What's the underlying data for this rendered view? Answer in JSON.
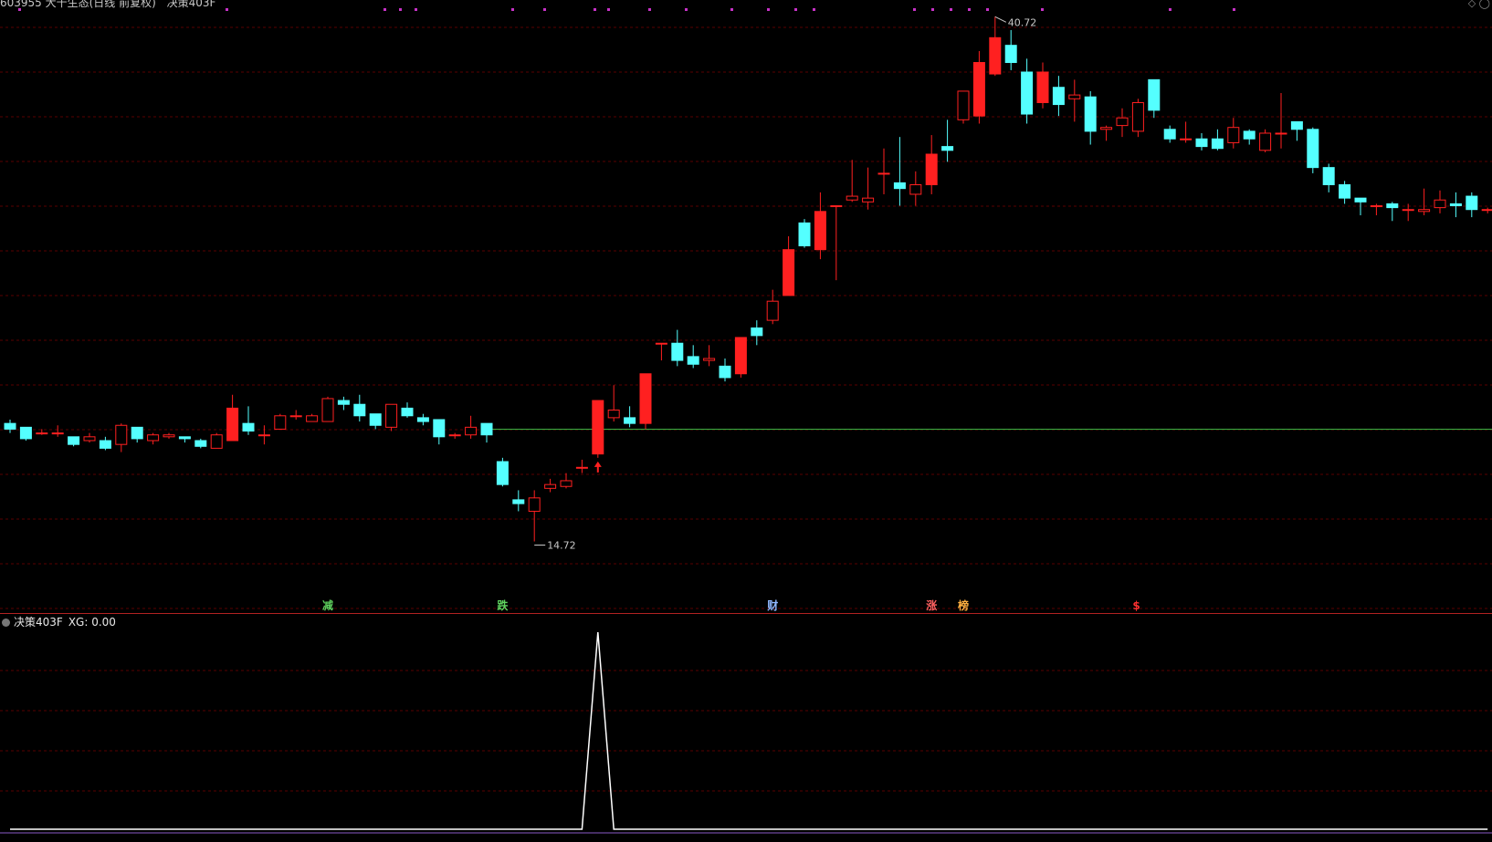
{
  "header": {
    "stock_title": "603955 大千生态(日线 前复权)",
    "formula_title": "决策403F",
    "corner_icon": "diamond-icon"
  },
  "indicator": {
    "name": "决策403F",
    "value_text": "XG: 0.00"
  },
  "price_labels": {
    "high": "40.72",
    "low": "14.72"
  },
  "signals": [
    {
      "text": "减",
      "index": 20,
      "color": "#5fd35f"
    },
    {
      "text": "跌",
      "index": 31,
      "color": "#5fd35f"
    },
    {
      "text": "财",
      "index": 48,
      "color": "#8fb7ff"
    },
    {
      "text": "涨",
      "index": 58,
      "color": "#ff6060"
    },
    {
      "text": "榜",
      "index": 60,
      "color": "#ffb040"
    },
    {
      "text": "$",
      "index": 71,
      "color": "#ff3030"
    }
  ],
  "colors": {
    "up": "#ff2020",
    "down": "#54ffff",
    "grid": "#5a0000",
    "support_line": "#3cb043",
    "indicator_line": "#ffffff",
    "dots": "#c832c8"
  },
  "chart_data": {
    "type": "candlestick",
    "price_range": [
      12.5,
      42.5
    ],
    "support_level": 20.6,
    "high_label_value": 40.72,
    "low_label_value": 14.72,
    "candles": [
      [
        20.9,
        20.6,
        21.1,
        20.4
      ],
      [
        20.7,
        20.1,
        20.7,
        20.0
      ],
      [
        20.4,
        20.4,
        20.6,
        20.3
      ],
      [
        20.4,
        20.4,
        20.8,
        20.2
      ],
      [
        20.2,
        19.8,
        20.2,
        19.7
      ],
      [
        20.0,
        20.2,
        20.4,
        19.9
      ],
      [
        20.0,
        19.6,
        20.2,
        19.5
      ],
      [
        19.8,
        20.8,
        20.9,
        19.4
      ],
      [
        20.7,
        20.1,
        20.7,
        19.9
      ],
      [
        20.0,
        20.3,
        20.4,
        19.8
      ],
      [
        20.2,
        20.3,
        20.4,
        20.1
      ],
      [
        20.2,
        20.1,
        20.2,
        19.9
      ],
      [
        20.0,
        19.7,
        20.1,
        19.6
      ],
      [
        19.6,
        20.3,
        20.4,
        19.6
      ],
      [
        20.0,
        21.7,
        22.4,
        20.0
      ],
      [
        20.9,
        20.5,
        21.8,
        20.3
      ],
      [
        20.3,
        20.3,
        20.8,
        19.8
      ],
      [
        20.6,
        21.3,
        21.4,
        20.6
      ],
      [
        21.3,
        21.3,
        21.6,
        21.1
      ],
      [
        21.0,
        21.3,
        21.4,
        21.0
      ],
      [
        21.0,
        22.2,
        22.3,
        21.0
      ],
      [
        22.1,
        21.9,
        22.3,
        21.6
      ],
      [
        21.9,
        21.3,
        22.4,
        21.0
      ],
      [
        21.4,
        20.8,
        21.4,
        20.6
      ],
      [
        20.7,
        21.9,
        21.9,
        20.5
      ],
      [
        21.7,
        21.3,
        22.0,
        21.2
      ],
      [
        21.2,
        21.0,
        21.4,
        20.8
      ],
      [
        21.1,
        20.2,
        21.1,
        19.8
      ],
      [
        20.3,
        20.3,
        20.4,
        20.1
      ],
      [
        20.3,
        20.7,
        21.3,
        20.1
      ],
      [
        20.9,
        20.3,
        20.9,
        19.9
      ],
      [
        18.9,
        17.7,
        19.1,
        17.6
      ],
      [
        16.9,
        16.7,
        17.4,
        16.3
      ],
      [
        16.3,
        17.0,
        17.4,
        14.72
      ],
      [
        17.5,
        17.7,
        18.0,
        17.3
      ],
      [
        17.6,
        17.9,
        18.3,
        17.5
      ],
      [
        18.6,
        18.6,
        19.0,
        18.3
      ],
      [
        19.3,
        22.1,
        22.1,
        19.1
      ],
      [
        21.2,
        21.6,
        22.9,
        21.0
      ],
      [
        21.2,
        20.9,
        21.8,
        20.7
      ],
      [
        20.9,
        23.5,
        23.5,
        20.6
      ],
      [
        25.1,
        25.1,
        25.1,
        24.2
      ],
      [
        25.1,
        24.2,
        25.8,
        23.9
      ],
      [
        24.4,
        24.0,
        25.0,
        23.8
      ],
      [
        24.2,
        24.3,
        25.0,
        23.9
      ],
      [
        23.9,
        23.3,
        24.3,
        23.1
      ],
      [
        23.5,
        25.4,
        25.4,
        23.3
      ],
      [
        25.9,
        25.5,
        26.3,
        25.0
      ],
      [
        26.3,
        27.3,
        27.9,
        26.1
      ],
      [
        27.6,
        30.0,
        30.7,
        27.6
      ],
      [
        31.4,
        30.2,
        31.6,
        30.1
      ],
      [
        30.0,
        32.0,
        33.0,
        29.5
      ],
      [
        32.3,
        32.3,
        32.3,
        28.4
      ],
      [
        32.6,
        32.8,
        34.7,
        32.5
      ],
      [
        32.5,
        32.7,
        34.3,
        32.1
      ],
      [
        34.0,
        34.0,
        35.3,
        32.9
      ],
      [
        33.5,
        33.2,
        35.9,
        32.3
      ],
      [
        32.9,
        33.4,
        34.1,
        32.3
      ],
      [
        33.4,
        35.0,
        36.0,
        32.9
      ],
      [
        35.4,
        35.2,
        36.8,
        34.6
      ],
      [
        36.8,
        38.3,
        38.3,
        36.6
      ],
      [
        37.0,
        39.8,
        40.4,
        36.6
      ],
      [
        39.2,
        41.1,
        42.2,
        39.1
      ],
      [
        40.7,
        39.8,
        41.5,
        39.4
      ],
      [
        39.3,
        37.1,
        40.0,
        36.6
      ],
      [
        37.7,
        39.3,
        39.8,
        37.4
      ],
      [
        38.5,
        37.6,
        39.1,
        37.0
      ],
      [
        37.9,
        38.1,
        38.9,
        36.7
      ],
      [
        38.0,
        36.2,
        38.3,
        35.5
      ],
      [
        36.3,
        36.4,
        36.5,
        35.7
      ],
      [
        36.5,
        36.9,
        37.4,
        35.9
      ],
      [
        36.2,
        37.7,
        37.9,
        35.9
      ],
      [
        38.9,
        37.3,
        38.9,
        36.9
      ],
      [
        36.3,
        35.8,
        36.5,
        35.6
      ],
      [
        35.8,
        35.8,
        36.7,
        35.6
      ],
      [
        35.8,
        35.4,
        36.1,
        35.2
      ],
      [
        35.8,
        35.3,
        36.3,
        35.2
      ],
      [
        35.6,
        36.4,
        36.9,
        35.3
      ],
      [
        36.2,
        35.8,
        36.3,
        35.5
      ],
      [
        35.2,
        36.1,
        36.3,
        35.1
      ],
      [
        36.1,
        36.1,
        38.2,
        35.3
      ],
      [
        36.7,
        36.3,
        36.6,
        35.7
      ],
      [
        36.3,
        34.3,
        36.4,
        34.0
      ],
      [
        34.3,
        33.4,
        34.5,
        33.0
      ],
      [
        33.4,
        32.7,
        33.6,
        32.4
      ],
      [
        32.7,
        32.5,
        32.7,
        31.8
      ],
      [
        32.3,
        32.3,
        32.4,
        31.8
      ],
      [
        32.4,
        32.2,
        32.5,
        31.5
      ],
      [
        32.1,
        32.1,
        32.4,
        31.5
      ],
      [
        32.0,
        32.1,
        33.2,
        31.8
      ],
      [
        32.2,
        32.6,
        33.1,
        31.9
      ],
      [
        32.4,
        32.3,
        33.0,
        31.7
      ],
      [
        32.8,
        32.1,
        33.0,
        31.7
      ],
      [
        32.1,
        32.1,
        32.2,
        31.9
      ]
    ],
    "indicator": {
      "name": "XG",
      "range": [
        0,
        1
      ],
      "values_nonzero": [
        {
          "index": 37,
          "value": 1
        }
      ]
    }
  }
}
